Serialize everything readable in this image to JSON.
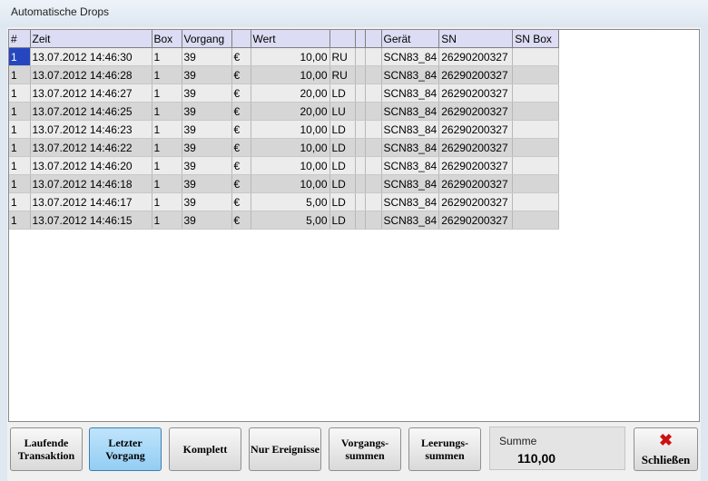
{
  "window": {
    "title": "Automatische Drops"
  },
  "table": {
    "columns": [
      "#",
      "Zeit",
      "Box",
      "Vorgang",
      "",
      "Wert",
      "",
      "",
      "",
      "Gerät",
      "SN",
      "SN Box"
    ],
    "rows": [
      [
        "1",
        "13.07.2012  14:46:30",
        "1",
        "39",
        "€",
        "10,00",
        "RU",
        "",
        "",
        "SCN83_84",
        "26290200327",
        ""
      ],
      [
        "1",
        "13.07.2012  14:46:28",
        "1",
        "39",
        "€",
        "10,00",
        "RU",
        "",
        "",
        "SCN83_84",
        "26290200327",
        ""
      ],
      [
        "1",
        "13.07.2012  14:46:27",
        "1",
        "39",
        "€",
        "20,00",
        "LD",
        "",
        "",
        "SCN83_84",
        "26290200327",
        ""
      ],
      [
        "1",
        "13.07.2012  14:46:25",
        "1",
        "39",
        "€",
        "20,00",
        "LU",
        "",
        "",
        "SCN83_84",
        "26290200327",
        ""
      ],
      [
        "1",
        "13.07.2012  14:46:23",
        "1",
        "39",
        "€",
        "10,00",
        "LD",
        "",
        "",
        "SCN83_84",
        "26290200327",
        ""
      ],
      [
        "1",
        "13.07.2012  14:46:22",
        "1",
        "39",
        "€",
        "10,00",
        "LD",
        "",
        "",
        "SCN83_84",
        "26290200327",
        ""
      ],
      [
        "1",
        "13.07.2012  14:46:20",
        "1",
        "39",
        "€",
        "10,00",
        "LD",
        "",
        "",
        "SCN83_84",
        "26290200327",
        ""
      ],
      [
        "1",
        "13.07.2012  14:46:18",
        "1",
        "39",
        "€",
        "10,00",
        "LD",
        "",
        "",
        "SCN83_84",
        "26290200327",
        ""
      ],
      [
        "1",
        "13.07.2012  14:46:17",
        "1",
        "39",
        "€",
        "5,00",
        "LD",
        "",
        "",
        "SCN83_84",
        "26290200327",
        ""
      ],
      [
        "1",
        "13.07.2012  14:46:15",
        "1",
        "39",
        "€",
        "5,00",
        "LD",
        "",
        "",
        "SCN83_84",
        "26290200327",
        ""
      ]
    ]
  },
  "buttons": {
    "laufende": "Laufende Transaktion",
    "letzter": "Letzter Vorgang",
    "komplett": "Komplett",
    "nur": "Nur Ereignisse",
    "vorgangs": "Vorgangs- summen",
    "leerungs": "Leerungs- summen"
  },
  "summe": {
    "label": "Summe",
    "value": "110,00"
  },
  "close": {
    "label": "Schließen",
    "icon": "close-x-icon"
  },
  "colors": {
    "selection": "#2646c0",
    "header": "#dcdcf4",
    "active_button": "#a8d8f7",
    "close_icon": "#cc1111"
  }
}
